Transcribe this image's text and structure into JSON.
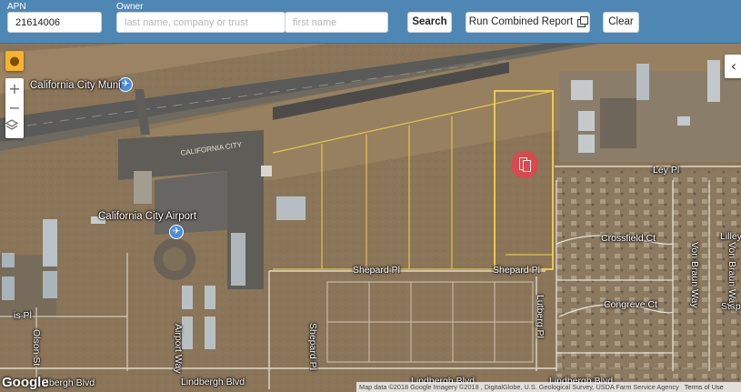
{
  "toolbar": {
    "apn_label": "APN",
    "apn_value": "21614006",
    "owner_label": "Owner",
    "owner_last_placeholder": "last name, company or trust",
    "owner_first_placeholder": "first name",
    "search_label": "Search",
    "combined_report_label": "Run Combined Report",
    "clear_label": "Clear"
  },
  "map_controls": {
    "pegman_icon": "pegman-icon",
    "zoom_in": "+",
    "zoom_out": "−",
    "layers_icon": "layers-icon",
    "collapse": "‹"
  },
  "map_labels": {
    "california_city_muni": "California City Muni",
    "california_city_airport": "California City Airport",
    "ley_pl": "Ley Pl",
    "crossfield_ct": "Crossfield Ct",
    "congreve_ct": "Congreve Ct",
    "shepard_pl_west": "Shepard Pl",
    "shepard_pl_east": "Shepard Pl",
    "lindbergh_blvd_west": "Lindbergh Blvd",
    "lindbergh_blvd_mid": "Lindbergh Blvd",
    "lindbergh_blvd_center": "Lindbergh Blvd",
    "lindbergh_blvd_east": "Lindbergh Blvd",
    "airport_way": "Airport Way",
    "shepard_pl_vertical": "Shepard Pl",
    "von_braun_way_1": "Von Braun Way",
    "von_braun_way_2": "Von Braun Way",
    "lutberg_pl": "Lutberg Pl",
    "olson_st": "Olson St",
    "lilley_partial": "Lilley",
    "stap_partial": "Stap",
    "is_pl_partial": "is Pl",
    "runway_marking": "CALIFORNIA CITY"
  },
  "google_logo": "Google",
  "attribution": {
    "imagery": "Map data ©2018 Google Imagery ©2018 , DigitalGlobe, U.S. Geological Survey, USDA Farm Service Agency",
    "terms": "Terms of Use"
  },
  "colors": {
    "header": "#4f87b4",
    "parcel_outline": "#f2d24a",
    "marker": "#e2454d",
    "airport_icon": "#4a8fd6"
  },
  "marker": {
    "icon": "parcel-document-icon"
  }
}
